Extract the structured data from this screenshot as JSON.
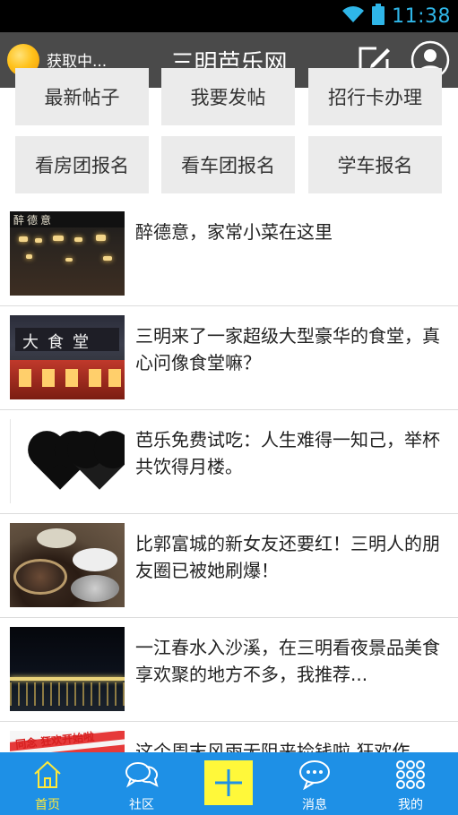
{
  "status_bar": {
    "time": "11:38",
    "accent": "#2fb6e8"
  },
  "header": {
    "weather_text": "获取中...",
    "title": "三明芭乐网",
    "background": "#4a4a4a",
    "edit_icon": "compose-icon",
    "user_icon": "user-avatar-icon"
  },
  "quick_actions": [
    {
      "label": "最新帖子"
    },
    {
      "label": "我要发帖"
    },
    {
      "label": "招行卡办理"
    },
    {
      "label": "看房团报名"
    },
    {
      "label": "看车团报名"
    },
    {
      "label": "学车报名"
    }
  ],
  "articles": [
    {
      "title": "醉德意，家常小菜在这里",
      "thumb_text": "醉德意"
    },
    {
      "title": "三明来了一家超级大型豪华的食堂，真心问像食堂嘛？",
      "thumb_text": "大食堂"
    },
    {
      "title": "芭乐免费试吃：人生难得一知己，举杯共饮得月楼。"
    },
    {
      "title": "比郭富城的新女友还要红！三明人的朋友圈已被她刷爆！"
    },
    {
      "title": "一江春水入沙溪，在三明看夜景品美食享欢聚的地方不多，我推荐..."
    },
    {
      "title": "这个周末风雨无阻来捡钱啦 狂欢作",
      "thumb_text": "同念 狂欢开始啦"
    }
  ],
  "bottom_nav": {
    "background": "#1e90e6",
    "active_color": "#ffe93b",
    "tabs": [
      {
        "label": "首页",
        "icon": "home-icon"
      },
      {
        "label": "社区",
        "icon": "chat-bubbles-icon"
      },
      {
        "label": "",
        "icon": "plus-icon"
      },
      {
        "label": "消息",
        "icon": "message-icon"
      },
      {
        "label": "我的",
        "icon": "grid-dots-icon"
      }
    ]
  }
}
